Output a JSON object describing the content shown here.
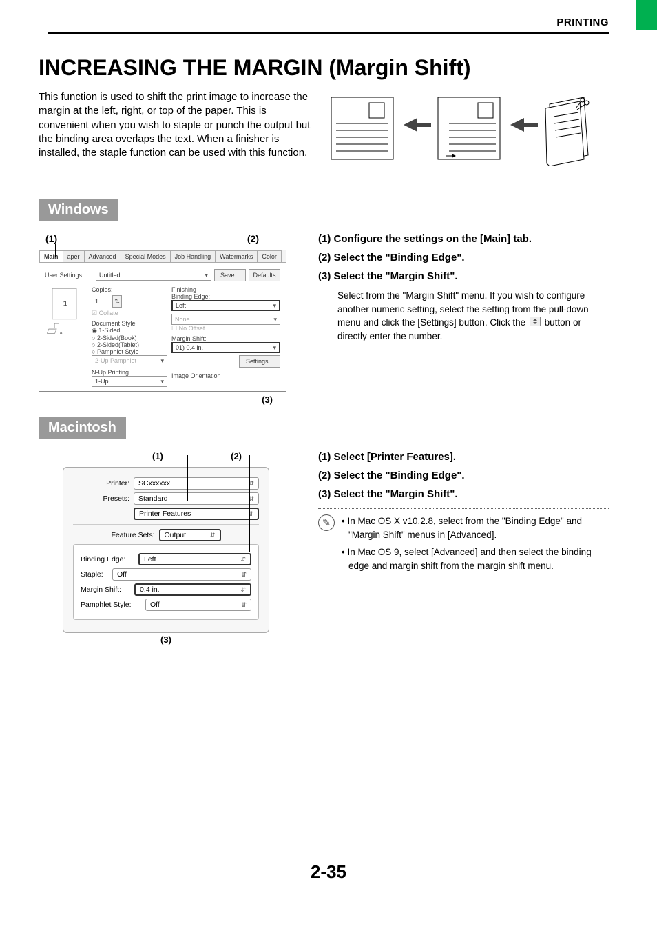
{
  "header": {
    "section": "PRINTING",
    "title": "INCREASING THE MARGIN (Margin Shift)",
    "intro": "This function is used to shift the print image to increase the margin at the left, right, or top of the paper. This is convenient when you wish to staple or punch the output but the binding area overlaps the text. When a finisher is installed, the staple function can be used with this function."
  },
  "os_headings": {
    "windows": "Windows",
    "mac": "Macintosh"
  },
  "win_callouts": {
    "c1": "(1)",
    "c2": "(2)",
    "c3": "(3)"
  },
  "win_dialog": {
    "tabs": [
      "Main",
      "aper",
      "Advanced",
      "Special Modes",
      "Job Handling",
      "Watermarks",
      "Color"
    ],
    "user_settings_lbl": "User Settings:",
    "user_settings_val": "Untitled",
    "save_btn": "Save...",
    "defaults_btn": "Defaults",
    "copies_lbl": "Copies:",
    "copies_val": "1",
    "collate": "Collate",
    "doc_style_lbl": "Document Style",
    "ds_1": "1-Sided",
    "ds_2": "2-Sided(Book)",
    "ds_3": "2-Sided(Tablet)",
    "ds_4": "Pamphlet Style",
    "pamphlet_dd": "2-Up Pamphlet",
    "nup_lbl": "N-Up Printing",
    "nup_val": "1-Up",
    "finishing_lbl": "Finishing",
    "binding_edge_lbl": "Binding Edge:",
    "binding_edge_val": "Left",
    "none_val": "None",
    "no_offset": "No Offset",
    "margin_shift_lbl": "Margin Shift:",
    "margin_shift_val": "01) 0.4 in.",
    "settings_btn": "Settings...",
    "image_orient": "Image Orientation",
    "preview_badge": "1"
  },
  "win_steps": {
    "s1": "(1)  Configure the settings on the [Main] tab.",
    "s2": "(2)  Select the \"Binding Edge\".",
    "s3": "(3)  Select the \"Margin Shift\".",
    "s3_detail": "Select from the \"Margin Shift\" menu. If you wish to configure another numeric setting, select the setting from the pull-down menu and click the [Settings] button. Click the  button or directly enter the number."
  },
  "mac_callouts": {
    "c1": "(1)",
    "c2": "(2)",
    "c3": "(3)"
  },
  "mac_dialog": {
    "printer_lbl": "Printer:",
    "printer_val": "SCxxxxxx",
    "presets_lbl": "Presets:",
    "presets_val": "Standard",
    "section_val": "Printer Features",
    "feature_sets_lbl": "Feature Sets:",
    "feature_sets_val": "Output",
    "binding_edge_lbl": "Binding Edge:",
    "binding_edge_val": "Left",
    "staple_lbl": "Staple:",
    "staple_val": "Off",
    "margin_shift_lbl": "Margin Shift:",
    "margin_shift_val": "0.4 in.",
    "pamphlet_lbl": "Pamphlet Style:",
    "pamphlet_val": "Off"
  },
  "mac_steps": {
    "s1": "(1)  Select [Printer Features].",
    "s2": "(2)  Select the \"Binding Edge\".",
    "s3": "(3)  Select the \"Margin Shift\"."
  },
  "mac_notes": {
    "n1": "In Mac OS X v10.2.8, select from the \"Binding Edge\" and \"Margin Shift\" menus in [Advanced].",
    "n2": "In Mac OS 9, select [Advanced] and then select the binding edge and margin shift from the margin shift menu."
  },
  "page_number": "2-35"
}
